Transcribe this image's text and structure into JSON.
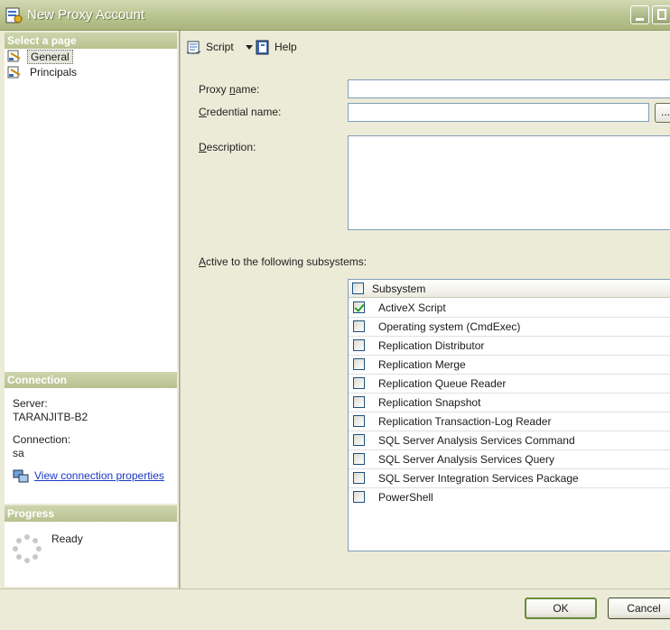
{
  "window": {
    "title": "New Proxy Account"
  },
  "left_pane": {
    "select_page_header": "Select a page",
    "pages": [
      {
        "label": "General",
        "icon": "page-icon",
        "selected": true
      },
      {
        "label": "Principals",
        "icon": "page-icon",
        "selected": false
      }
    ],
    "connection_header": "Connection",
    "server_label": "Server:",
    "server_value": "TARANJITB-B2",
    "connection_label": "Connection:",
    "connection_value": "sa",
    "view_connection_link": "View connection properties",
    "progress_header": "Progress",
    "progress_status": "Ready"
  },
  "toolbar": {
    "script_label": "Script",
    "help_label": "Help"
  },
  "form": {
    "proxy_name_label_pre": "Proxy ",
    "proxy_name_label_u": "n",
    "proxy_name_label_post": "ame:",
    "proxy_name_value": "",
    "credential_name_label_u": "C",
    "credential_name_label_post": "redential name:",
    "credential_name_value": "",
    "browse_label": "...",
    "description_label_u": "D",
    "description_label_post": "escription:",
    "description_value": "",
    "subsystems_label_u": "A",
    "subsystems_label_post": "ctive to the following subsystems:"
  },
  "subsystems": {
    "header": "Subsystem",
    "rows": [
      {
        "name": "ActiveX Script",
        "checked": true
      },
      {
        "name": "Operating system (CmdExec)",
        "checked": false
      },
      {
        "name": "Replication Distributor",
        "checked": false
      },
      {
        "name": "Replication Merge",
        "checked": false
      },
      {
        "name": "Replication Queue Reader",
        "checked": false
      },
      {
        "name": "Replication Snapshot",
        "checked": false
      },
      {
        "name": "Replication Transaction-Log Reader",
        "checked": false
      },
      {
        "name": "SQL Server Analysis Services Command",
        "checked": false
      },
      {
        "name": "SQL Server Analysis Services Query",
        "checked": false
      },
      {
        "name": "SQL Server Integration Services Package",
        "checked": false
      },
      {
        "name": "PowerShell",
        "checked": false
      }
    ]
  },
  "buttons": {
    "ok": "OK",
    "cancel": "Cancel"
  },
  "colors": {
    "titlebar": "#b9c38f",
    "panel_bg": "#ecebd8",
    "link": "#1a38c6",
    "check": "#21a121"
  }
}
